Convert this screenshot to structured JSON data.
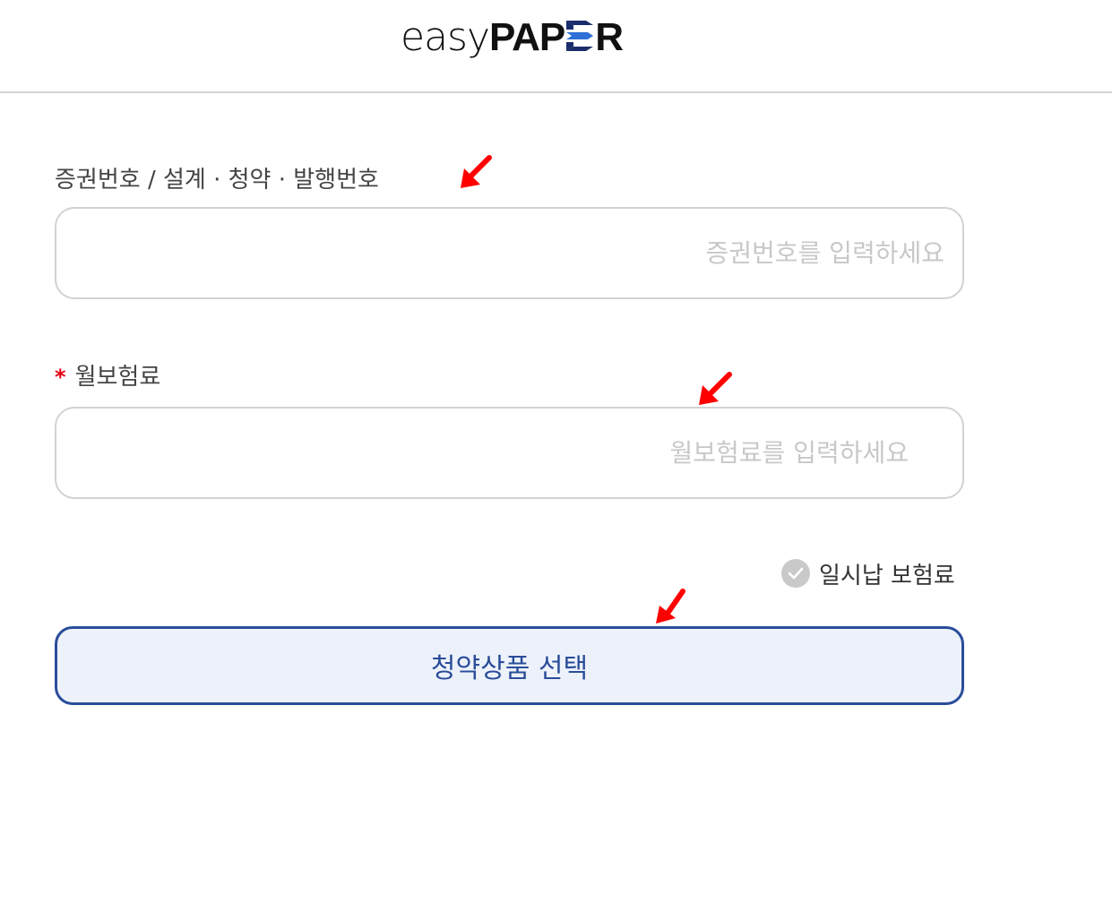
{
  "header": {
    "logo_easy": "easy",
    "logo_pa": "PAP",
    "logo_r": "R",
    "logo_colors": {
      "dark": "#1a2d6b",
      "light": "#2f6fd6"
    }
  },
  "form": {
    "certificate": {
      "label": "증권번호 / 설계 · 청약 · 발행번호",
      "placeholder": "증권번호를 입력하세요",
      "value": ""
    },
    "premium": {
      "required_mark": "*",
      "label": "월보험료",
      "placeholder": "월보험료를 입력하세요",
      "value": ""
    },
    "lump_sum": {
      "label": "일시납 보험료",
      "checked": false
    },
    "select_button_label": "청약상품 선택"
  },
  "annotations": {
    "arrow_color": "#ff0000",
    "arrow_icon": "red-arrow-down-left"
  }
}
